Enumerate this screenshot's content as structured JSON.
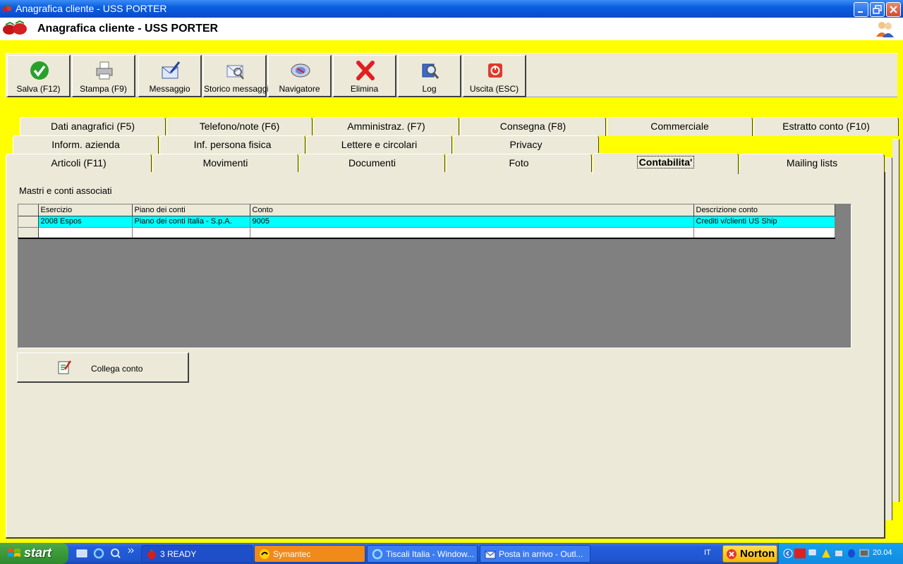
{
  "window": {
    "title": "Anagrafica cliente - USS PORTER",
    "buttons": [
      "minimize",
      "restore",
      "close"
    ]
  },
  "header": {
    "title": "Anagrafica cliente - USS PORTER"
  },
  "toolbar": {
    "buttons": [
      {
        "label": "Salva (F12)",
        "icon": "check-icon"
      },
      {
        "label": "Stampa (F9)",
        "icon": "printer-icon"
      },
      {
        "label": "Messaggio",
        "icon": "envelope-pen-icon"
      },
      {
        "label": "Storico messaggi",
        "icon": "envelope-search-icon"
      },
      {
        "label": "Navigatore",
        "icon": "navigator-icon"
      },
      {
        "label": "Elimina",
        "icon": "red-x-icon"
      },
      {
        "label": "Log",
        "icon": "magnifier-book-icon"
      },
      {
        "label": "Uscita (ESC)",
        "icon": "power-icon"
      }
    ]
  },
  "tabs": {
    "row1": [
      "Dati anagrafici (F5)",
      "Telefono/note (F6)",
      "Amministraz. (F7)",
      "Consegna (F8)",
      "Commerciale",
      "Estratto conto (F10)"
    ],
    "row2": [
      "Inform. azienda",
      "Inf. persona fisica",
      "Lettere e circolari",
      "Privacy"
    ],
    "row3": [
      "Articoli (F11)",
      "Movimenti",
      "Documenti",
      "Foto",
      "Contabilita'",
      "Mailing lists"
    ],
    "active": "Contabilita'"
  },
  "panel": {
    "section_label": "Mastri e conti associati",
    "grid": {
      "columns": [
        "Esercizio",
        "Piano dei conti",
        "Conto",
        "Descrizione conto"
      ],
      "rows": [
        [
          "2008 Espos",
          "Piano dei conti Italia - S.p.A.",
          "9005",
          "Crediti v/clienti US Ship"
        ]
      ]
    },
    "collega_button": "Collega conto"
  },
  "taskbar": {
    "start": "start",
    "tasks": [
      {
        "label": "3 READY"
      },
      {
        "label": "Symantec"
      },
      {
        "label": "Tiscali Italia - Window..."
      },
      {
        "label": "Posta in arrivo - Outl..."
      }
    ],
    "language": "IT",
    "norton": "Norton",
    "clock": "20.04"
  },
  "colors": {
    "background": "#ffff00",
    "title_bar": "#0a54d8",
    "selected_row": "#00ffff",
    "face": "#ece9d8"
  }
}
